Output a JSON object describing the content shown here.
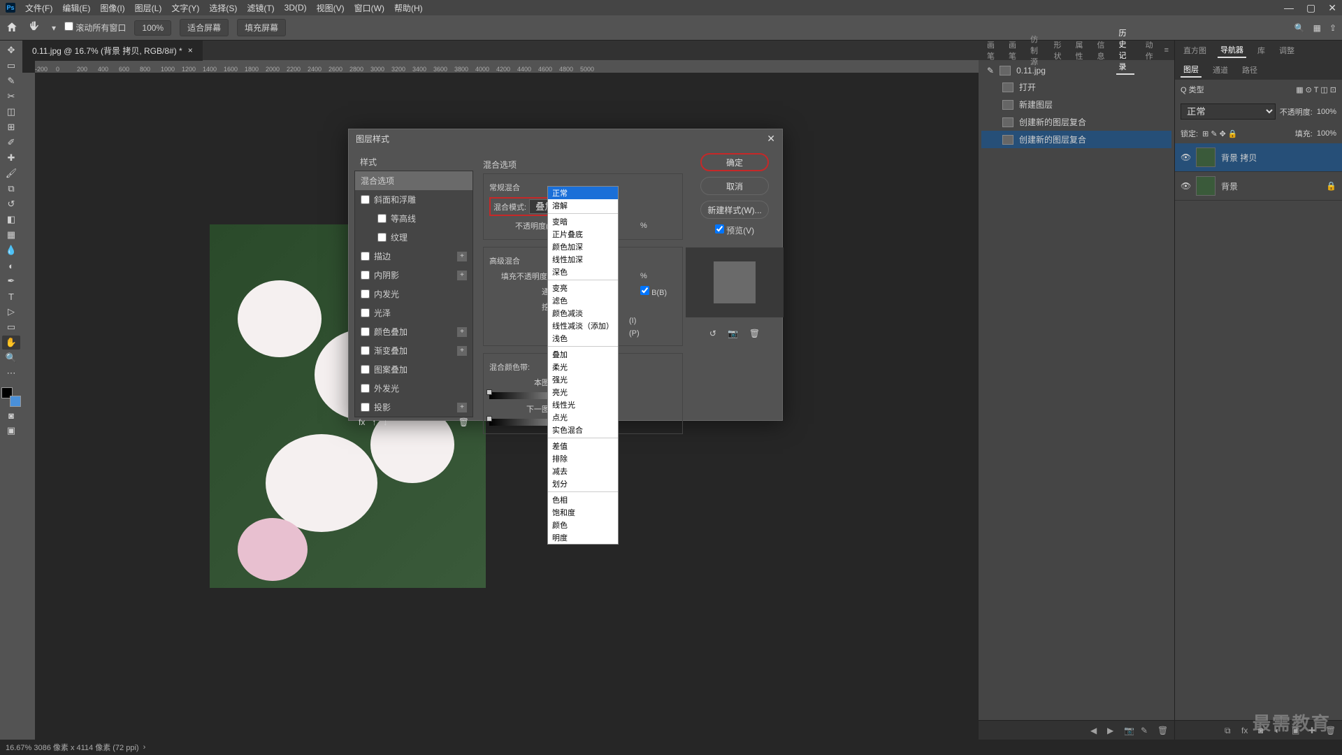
{
  "menu": {
    "items": [
      "文件(F)",
      "编辑(E)",
      "图像(I)",
      "图层(L)",
      "文字(Y)",
      "选择(S)",
      "滤镜(T)",
      "3D(D)",
      "视图(V)",
      "窗口(W)",
      "帮助(H)"
    ]
  },
  "optbar": {
    "scrollAll": "滚动所有窗口",
    "zoom": "100%",
    "fitScreen": "适合屏幕",
    "fillScreen": "填充屏幕"
  },
  "doc": {
    "tab": "0.11.jpg @ 16.7% (背景 拷贝, RGB/8#) *"
  },
  "ruler": {
    "marks": [
      "-200",
      "0",
      "200",
      "400",
      "600",
      "800",
      "1000",
      "1200",
      "1400",
      "1600",
      "1800",
      "2000",
      "2200",
      "2400",
      "2600",
      "2800",
      "3000",
      "3200",
      "3400",
      "3600",
      "3800",
      "4000",
      "4200",
      "4400",
      "4600",
      "4800",
      "5000"
    ]
  },
  "rightPanels": {
    "tabs1": [
      "画笔",
      "画笔",
      "仿制源",
      "形状",
      "属性",
      "信息",
      "历史记录",
      "动作"
    ],
    "active1": "历史记录",
    "history": [
      {
        "label": "0.11.jpg",
        "thumbIcon": true
      },
      {
        "label": "打开"
      },
      {
        "label": "新建图层"
      },
      {
        "label": "创建新的图层复合"
      },
      {
        "label": "创建新的图层复合",
        "sel": true
      }
    ]
  },
  "farPanels": {
    "tabs1": [
      "直方图",
      "导航器",
      "库",
      "调整"
    ],
    "active1": "导航器",
    "tabs2": [
      "图层",
      "通道",
      "路径"
    ],
    "active2": "图层",
    "layersCtrl": {
      "kind": "Q 类型",
      "mode": "正常",
      "opacityLbl": "不透明度:",
      "opacity": "100%",
      "lockLbl": "锁定:",
      "fillLbl": "填充:",
      "fill": "100%"
    },
    "layers": [
      {
        "name": "背景 拷贝",
        "sel": true
      },
      {
        "name": "背景",
        "locked": true
      }
    ]
  },
  "status": "16.67% 3086 像素 x 4114 像素 (72 ppi)",
  "dialog": {
    "title": "图层样式",
    "styleHdr": "样式",
    "styles": [
      {
        "label": "混合选项",
        "sel": true,
        "noCheck": true
      },
      {
        "label": "斜面和浮雕"
      },
      {
        "label": "等高线",
        "indent": true
      },
      {
        "label": "纹理",
        "indent": true
      },
      {
        "label": "描边",
        "plus": true
      },
      {
        "label": "内阴影",
        "plus": true
      },
      {
        "label": "内发光"
      },
      {
        "label": "光泽"
      },
      {
        "label": "颜色叠加",
        "plus": true
      },
      {
        "label": "渐变叠加",
        "plus": true
      },
      {
        "label": "图案叠加"
      },
      {
        "label": "外发光"
      },
      {
        "label": "投影",
        "plus": true
      }
    ],
    "blend": {
      "sectionTitle": "混合选项",
      "general": "常规混合",
      "modeLbl": "混合模式:",
      "modeVal": "叠加",
      "opacityLbl": "不透明度(O):",
      "opacitySuffix": "%",
      "advanced": "高级混合",
      "fillOpLbl": "填充不透明度(F):",
      "fillSuffix": "%",
      "channelsLbl": "通道:",
      "knockoutLbl": "挖空:",
      "cbB": "B(B)",
      "cbI": "(I)",
      "cbP": "(P)",
      "blendIf": "混合颜色带:",
      "thisLayer": "本图层:",
      "nextLayer": "下一图层:"
    },
    "buttons": {
      "ok": "确定",
      "cancel": "取消",
      "newStyle": "新建样式(W)...",
      "preview": "预览(V)"
    }
  },
  "dropdown": {
    "groups": [
      [
        "正常",
        "溶解"
      ],
      [
        "变暗",
        "正片叠底",
        "颜色加深",
        "线性加深",
        "深色"
      ],
      [
        "变亮",
        "滤色",
        "颜色减淡",
        "线性减淡（添加）",
        "浅色"
      ],
      [
        "叠加",
        "柔光",
        "强光",
        "亮光",
        "线性光",
        "点光",
        "实色混合"
      ],
      [
        "差值",
        "排除",
        "减去",
        "划分"
      ],
      [
        "色相",
        "饱和度",
        "颜色",
        "明度"
      ]
    ],
    "highlighted": "正常"
  },
  "watermark": "最需教育"
}
